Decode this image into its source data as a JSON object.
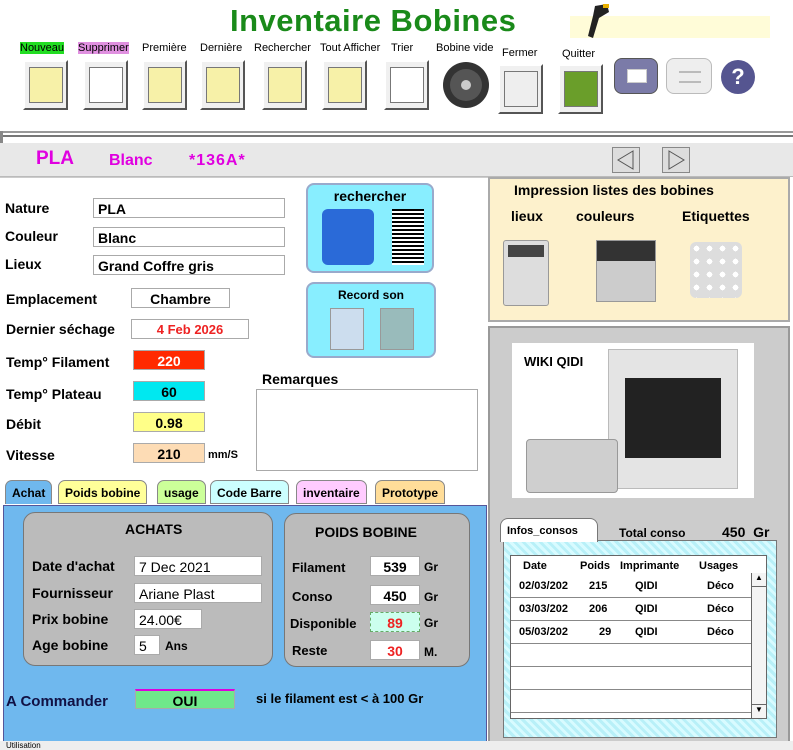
{
  "app_title": "Inventaire Bobines",
  "toolbar": [
    {
      "label": "Nouveau",
      "bg": "#22cc22"
    },
    {
      "label": "Supprimer",
      "bg": "#e090e0"
    },
    {
      "label": "Première",
      "bg": ""
    },
    {
      "label": "Dernière",
      "bg": ""
    },
    {
      "label": "Rechercher",
      "bg": ""
    },
    {
      "label": "Tout Afficher",
      "bg": ""
    },
    {
      "label": "Trier",
      "bg": ""
    },
    {
      "label": "Bobine vide",
      "bg": ""
    },
    {
      "label": "Fermer",
      "bg": ""
    },
    {
      "label": "Quitter",
      "bg": ""
    }
  ],
  "record": {
    "nature": "PLA",
    "couleur": "Blanc",
    "id": "*136A*"
  },
  "fields": {
    "nature_label": "Nature",
    "nature": "PLA",
    "couleur_label": "Couleur",
    "couleur": "Blanc",
    "lieux_label": "Lieux",
    "lieux": "Grand Coffre gris",
    "emplacement_label": "Emplacement",
    "emplacement": "Chambre",
    "sechage_label": "Dernier séchage",
    "sechage": "4 Feb 2026",
    "temp_fil_label": "Temp° Filament",
    "temp_fil": "220",
    "temp_plat_label": "Temp°  Plateau",
    "temp_plat": "60",
    "debit_label": "Débit",
    "debit": "0.98",
    "vitesse_label": "Vitesse",
    "vitesse": "210",
    "vitesse_unit": "mm/S",
    "remarques_label": "Remarques"
  },
  "buttons": {
    "rechercher": "rechercher",
    "record_son": "Record son"
  },
  "impression": {
    "title": "Impression listes des bobines",
    "lieux": "lieux",
    "couleurs": "couleurs",
    "etiquettes": "Etiquettes"
  },
  "wiki": "WIKI QIDI",
  "tabs": [
    "Achat",
    "Poids bobine",
    "usage",
    "Code Barre",
    "inventaire",
    "Prototype"
  ],
  "achats": {
    "title": "ACHATS",
    "date_label": "Date d'achat",
    "date": "7 Dec 2021",
    "fourn_label": "Fournisseur",
    "fourn": "Ariane Plast",
    "prix_label": "Prix bobine",
    "prix": "24.00€",
    "age_label": "Age bobine",
    "age": "5",
    "age_unit": "Ans"
  },
  "poids": {
    "title": "POIDS BOBINE",
    "filament_label": "Filament",
    "filament": "539",
    "conso_label": "Conso",
    "conso": "450",
    "dispo_label": "Disponible",
    "dispo": "89",
    "reste_label": "Reste",
    "reste": "30",
    "unit_gr": "Gr",
    "unit_m": "M."
  },
  "commander": {
    "label": "A Commander",
    "value": "OUI",
    "note": "si le filament est < à 100 Gr"
  },
  "consos": {
    "tab": "Infos_consos",
    "total_label": "Total conso",
    "total": "450  Gr",
    "headers": [
      "Date",
      "Poids",
      "Imprimante",
      "Usages"
    ],
    "rows": [
      [
        "02/03/202",
        "215",
        "QIDI",
        "Déco"
      ],
      [
        "03/03/202",
        "206",
        "QIDI",
        "Déco"
      ],
      [
        "05/03/202",
        "29",
        "QIDI",
        "Déco"
      ]
    ]
  },
  "status": "Utilisation"
}
